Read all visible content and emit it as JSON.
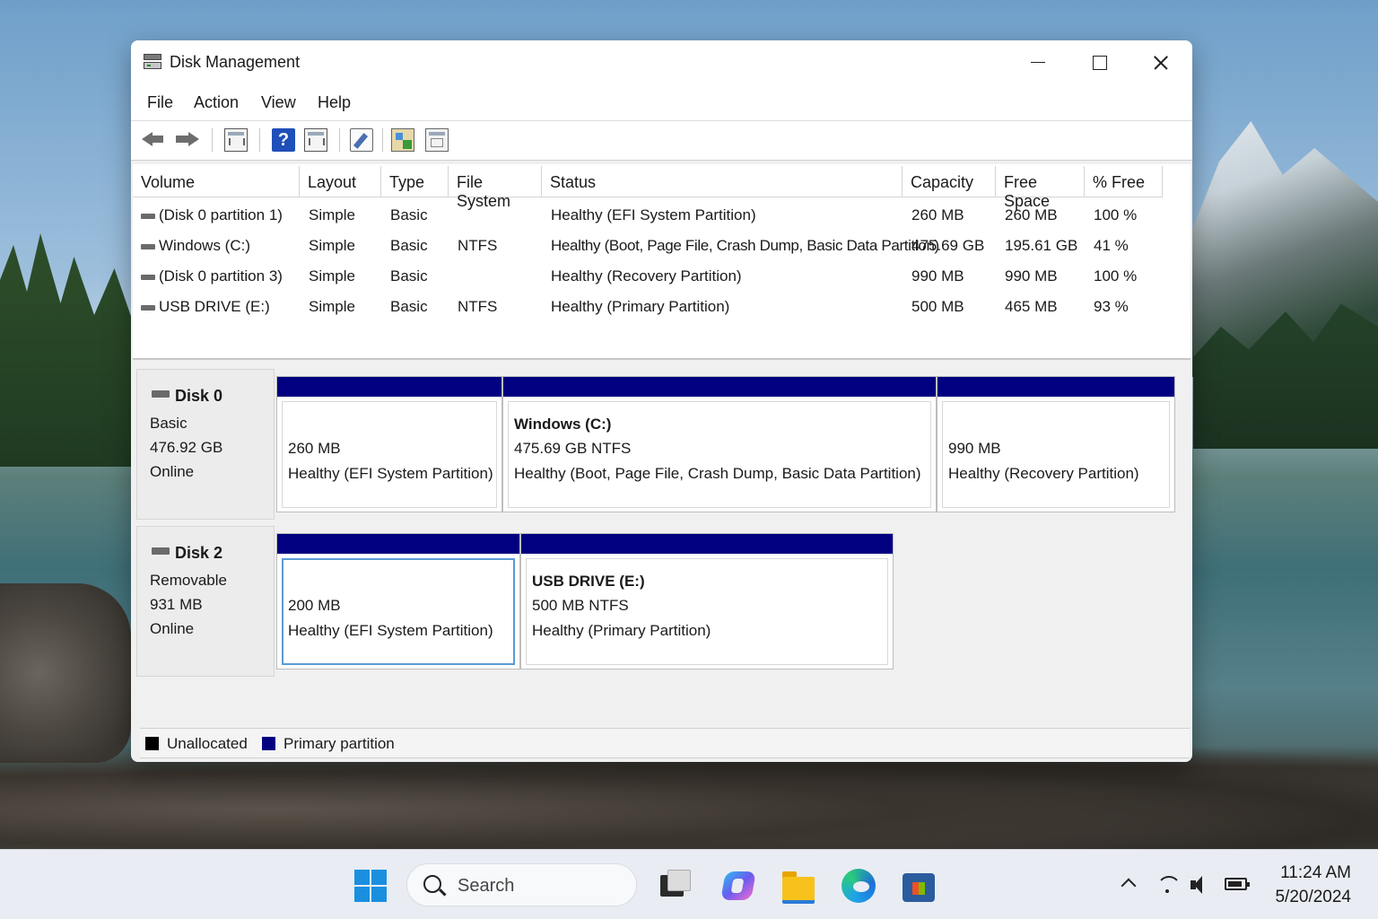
{
  "window": {
    "title": "Disk Management",
    "app_icon": "disk-management-icon"
  },
  "menu": [
    "File",
    "Action",
    "View",
    "Help"
  ],
  "toolbar": {
    "icons": [
      "back-arrow-icon",
      "forward-arrow-icon",
      "disk-list-icon",
      "help-icon",
      "console-tree-icon",
      "edit-icon",
      "disk-properties-icon",
      "show-hide-icon"
    ]
  },
  "volumes": {
    "columns": [
      "Volume",
      "Layout",
      "Type",
      "File System",
      "Status",
      "Capacity",
      "Free Space",
      "% Free"
    ],
    "rows": [
      {
        "volume": "(Disk 0 partition 1)",
        "layout": "Simple",
        "type": "Basic",
        "fs": "",
        "status": "Healthy (EFI System Partition)",
        "capacity": "260 MB",
        "free": "260 MB",
        "pct": "100 %"
      },
      {
        "volume": "Windows (C:)",
        "layout": "Simple",
        "type": "Basic",
        "fs": "NTFS",
        "status": "Healthy (Boot, Page File, Crash Dump, Basic Data Partition)",
        "capacity": "475.69 GB",
        "free": "195.61 GB",
        "pct": "41 %"
      },
      {
        "volume": "(Disk 0 partition 3)",
        "layout": "Simple",
        "type": "Basic",
        "fs": "",
        "status": "Healthy (Recovery Partition)",
        "capacity": "990 MB",
        "free": "990 MB",
        "pct": "100 %"
      },
      {
        "volume": "USB DRIVE (E:)",
        "layout": "Simple",
        "type": "Basic",
        "fs": "NTFS",
        "status": "Healthy (Primary Partition)",
        "capacity": "500 MB",
        "free": "465 MB",
        "pct": "93 %"
      }
    ]
  },
  "disks": [
    {
      "name": "Disk 0",
      "kind": "Basic",
      "size": "476.92 GB",
      "state": "Online",
      "partitions": [
        {
          "title": "",
          "line1": "260 MB",
          "line2": "Healthy (EFI System Partition)"
        },
        {
          "title": "Windows  (C:)",
          "line1": "475.69 GB NTFS",
          "line2": "Healthy (Boot, Page File, Crash Dump, Basic Data Partition)"
        },
        {
          "title": "",
          "line1": "990 MB",
          "line2": "Healthy (Recovery Partition)"
        }
      ]
    },
    {
      "name": "Disk 2",
      "kind": "Removable",
      "size": "931 MB",
      "state": "Online",
      "partitions": [
        {
          "title": "",
          "line1": "200 MB",
          "line2": "Healthy (EFI System Partition)"
        },
        {
          "title": "USB DRIVE  (E:)",
          "line1": "500 MB NTFS",
          "line2": "Healthy (Primary Partition)"
        }
      ]
    }
  ],
  "legend": [
    {
      "label": "Unallocated",
      "color": "#000000"
    },
    {
      "label": "Primary partition",
      "color": "#000080"
    }
  ],
  "colors": {
    "primary_bar": "#000080",
    "selection": "#5b9bd5"
  },
  "taskbar": {
    "search_placeholder": "Search",
    "apps": [
      "start-icon",
      "task-view-icon",
      "copilot-icon",
      "file-explorer-icon",
      "edge-icon",
      "store-icon"
    ],
    "tray": [
      "chevron-up-icon",
      "wifi-icon",
      "volume-icon",
      "battery-icon"
    ],
    "time": "11:24 AM",
    "date": "5/20/2024"
  }
}
